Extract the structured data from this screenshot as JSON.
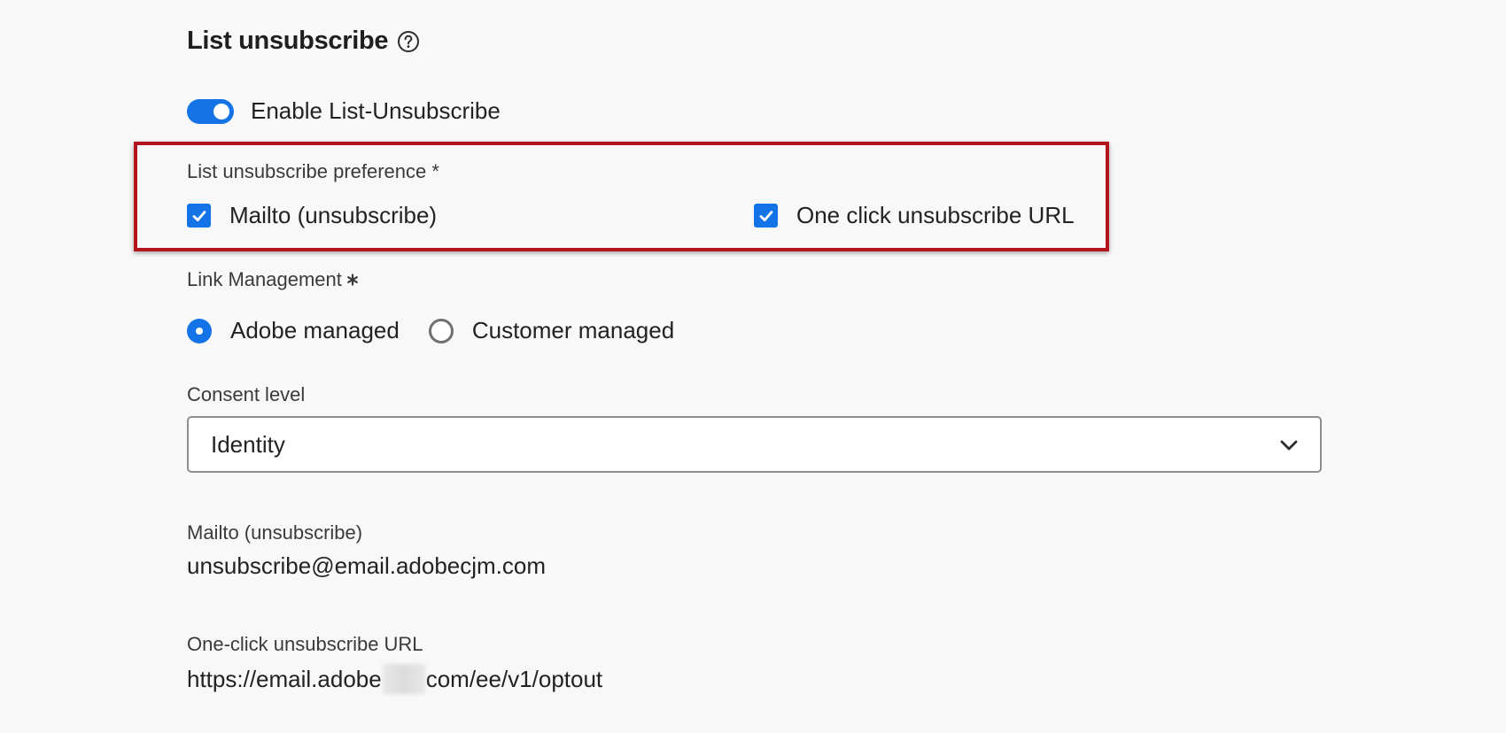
{
  "section": {
    "title": "List unsubscribe"
  },
  "toggle": {
    "label": "Enable List-Unsubscribe",
    "on": true
  },
  "preference": {
    "label": "List unsubscribe preference *",
    "options": [
      {
        "label": "Mailto (unsubscribe)",
        "checked": true
      },
      {
        "label": "One click unsubscribe URL",
        "checked": true
      }
    ]
  },
  "link_management": {
    "label": "Link Management",
    "options": [
      {
        "label": "Adobe managed",
        "selected": true
      },
      {
        "label": "Customer managed",
        "selected": false
      }
    ]
  },
  "consent": {
    "label": "Consent level",
    "value": "Identity"
  },
  "mailto": {
    "label": "Mailto (unsubscribe)",
    "value": "unsubscribe@email.adobecjm.com"
  },
  "one_click": {
    "label": "One-click unsubscribe URL",
    "value_prefix": "https://email.adobe",
    "value_suffix": "com/ee/v1/optout"
  },
  "colors": {
    "accent": "#1473e6",
    "highlight": "#b5141c"
  },
  "icons": {
    "help": "help-circle-icon",
    "check": "checkmark-icon",
    "chevron": "chevron-down-icon",
    "required": "asterisk-icon"
  }
}
